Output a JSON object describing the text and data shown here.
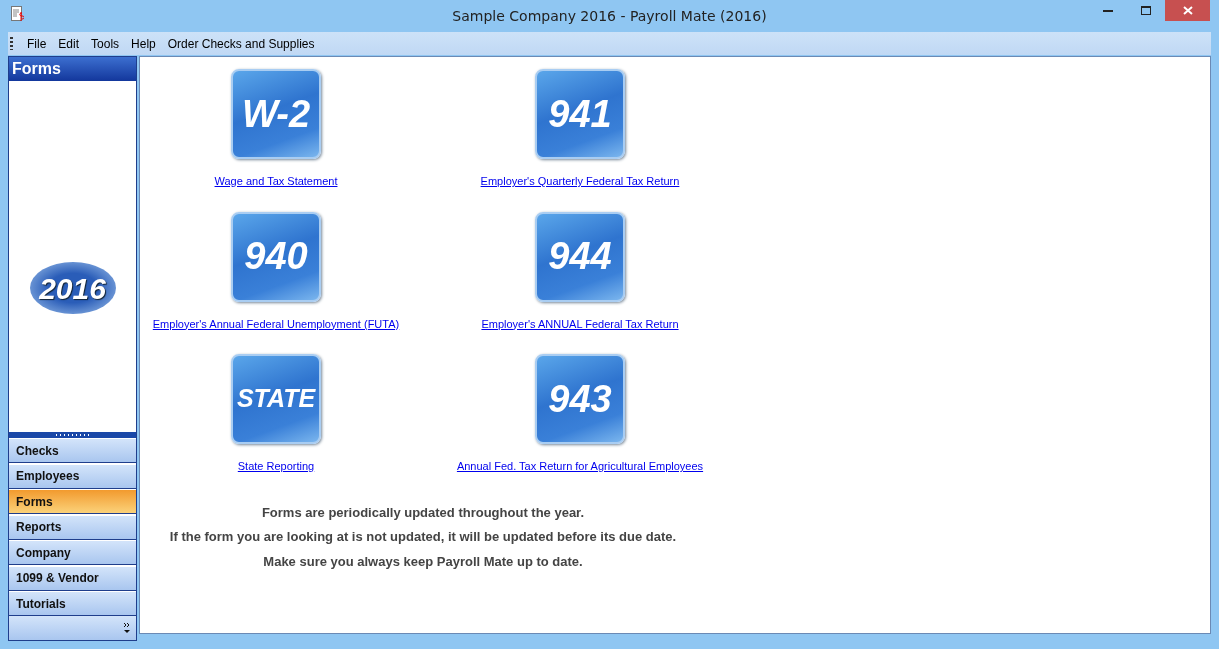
{
  "window": {
    "title": "Sample Company 2016 - Payroll Mate (2016)"
  },
  "menu": [
    "File",
    "Edit",
    "Tools",
    "Help",
    "Order Checks and Supplies"
  ],
  "sidebar": {
    "header": "Forms",
    "logo_text": "2016",
    "items": [
      {
        "label": "Checks",
        "selected": false
      },
      {
        "label": "Employees",
        "selected": false
      },
      {
        "label": "Forms",
        "selected": true
      },
      {
        "label": "Reports",
        "selected": false
      },
      {
        "label": "Company",
        "selected": false
      },
      {
        "label": "1099 & Vendor",
        "selected": false
      },
      {
        "label": "Tutorials",
        "selected": false
      }
    ]
  },
  "forms": [
    {
      "icon_text": "W-2",
      "label": "Wage and Tax Statement"
    },
    {
      "icon_text": "941",
      "label": "Employer's Quarterly Federal Tax Return"
    },
    {
      "icon_text": "940",
      "label": "Employer's Annual Federal Unemployment (FUTA)"
    },
    {
      "icon_text": "944",
      "label": "Employer's ANNUAL Federal Tax Return"
    },
    {
      "icon_text": "STATE",
      "label": "State Reporting"
    },
    {
      "icon_text": "943",
      "label": "Annual Fed. Tax Return for Agricultural Employees"
    }
  ],
  "notes": [
    "Forms are periodically updated throughout the year.",
    "If the form you are looking at is not updated, it will be updated before its due date.",
    "Make sure you always keep Payroll Mate up to date."
  ]
}
